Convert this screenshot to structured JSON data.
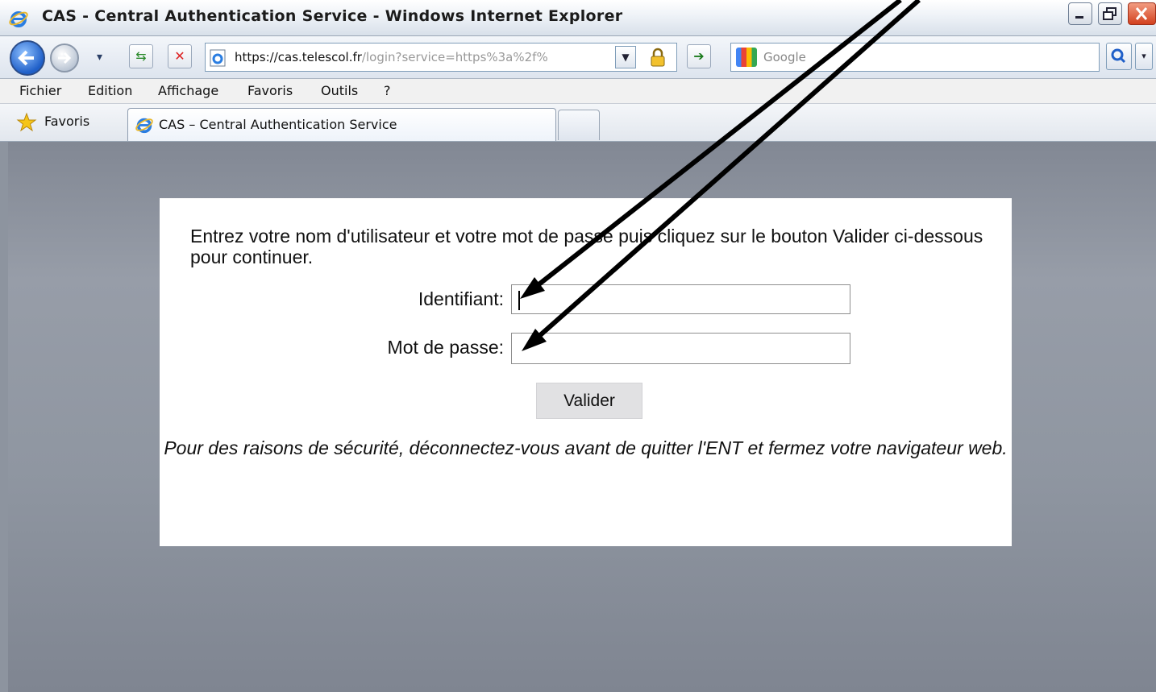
{
  "window": {
    "title": "CAS - Central Authentication Service - Windows Internet Explorer",
    "controls": [
      "minimize-icon",
      "restore-icon",
      "close-icon"
    ]
  },
  "address_bar": {
    "url_scheme_host": "https://cas.telescol.fr",
    "url_path": "/login?service=https%3a%2f%",
    "search_placeholder": "Google",
    "go_icon": "arrow-right-icon",
    "security_icon": "padlock-icon"
  },
  "menu": [
    "Fichier",
    "Edition",
    "Affichage",
    "Favoris",
    "Outils",
    "?"
  ],
  "favorites_bar": {
    "favorites_label": "Favoris",
    "active_tab_title": "CAS – Central Authentication Service"
  },
  "login": {
    "instructions": "Entrez votre nom d'utilisateur et votre mot de passe puis cliquez sur le bouton Valider ci-dessous pour continuer.",
    "username_label": "Identifiant:",
    "username_value": "",
    "password_label": "Mot de passe:",
    "password_value": "",
    "submit_label": "Valider",
    "security_note": "Pour des raisons de sécurité, déconnectez-vous avant de quitter l'ENT et fermez votre navigateur web."
  },
  "colors": {
    "accent": "#1f5fc8",
    "content_background": "#8d949f",
    "panel": "#ffffff",
    "button": "#e1e1e3",
    "annotation_arrow": "#000000"
  }
}
